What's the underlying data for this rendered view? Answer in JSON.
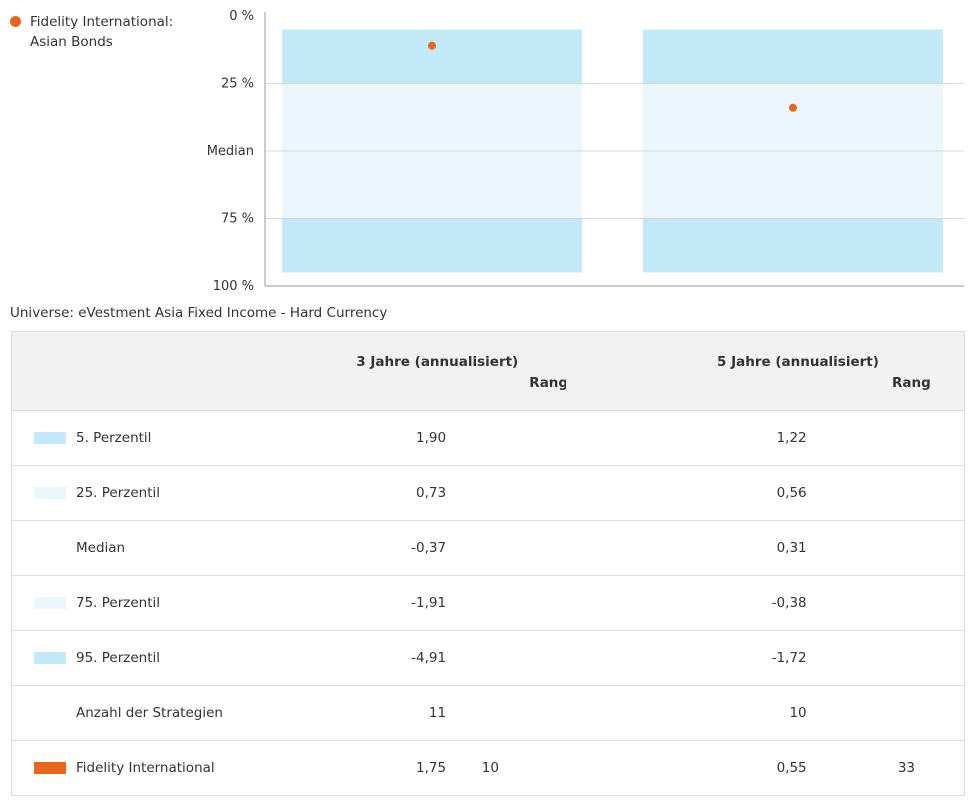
{
  "legend": {
    "line1": "Fidelity International:",
    "line2": "Asian Bonds",
    "color": "#e8671e"
  },
  "colors": {
    "outer_band": "#c3e8f7",
    "inner_band": "#ebf7fc",
    "fund": "#e8671e",
    "grid": "#d9d9d9",
    "axis": "#999999"
  },
  "chart_data": {
    "type": "percentile-range",
    "y_axis": {
      "ticks": [
        "0 %",
        "25 %",
        "Median",
        "75 %",
        "100 %"
      ],
      "tick_values": [
        0,
        25,
        50,
        75,
        100
      ],
      "reversed": true,
      "range": [
        0,
        100
      ]
    },
    "bands": {
      "outer": [
        5,
        95
      ],
      "inner": [
        25,
        75
      ]
    },
    "series": [
      {
        "name": "Fidelity International: Asian Bonds",
        "values": [
          11,
          34
        ]
      }
    ],
    "categories": [
      "3 Jahre (annualisiert)",
      "5 Jahre (annualisiert)"
    ]
  },
  "universe": "Universe: eVestment Asia Fixed Income - Hard Currency",
  "table": {
    "headers": {
      "p3": "3 Jahre (annualisiert)",
      "p5": "5 Jahre (annualisiert)",
      "rang": "Rang"
    },
    "rows": [
      {
        "label": "5. Perzentil",
        "swatch": "#c3e8f7",
        "v3": "1,90",
        "r3": "",
        "v5": "1,22",
        "r5": ""
      },
      {
        "label": "25. Perzentil",
        "swatch": "#ebf7fc",
        "v3": "0,73",
        "r3": "",
        "v5": "0,56",
        "r5": ""
      },
      {
        "label": "Median",
        "swatch": "",
        "v3": "-0,37",
        "r3": "",
        "v5": "0,31",
        "r5": ""
      },
      {
        "label": "75. Perzentil",
        "swatch": "#ebf7fc",
        "v3": "-1,91",
        "r3": "",
        "v5": "-0,38",
        "r5": ""
      },
      {
        "label": "95. Perzentil",
        "swatch": "#c3e8f7",
        "v3": "-4,91",
        "r3": "",
        "v5": "-1,72",
        "r5": ""
      },
      {
        "label": "Anzahl der Strategien",
        "swatch": "",
        "v3": "11",
        "r3": "",
        "v5": "10",
        "r5": ""
      },
      {
        "label": "Fidelity International",
        "swatch": "#e8671e",
        "v3": "1,75",
        "r3": "10",
        "v5": "0,55",
        "r5": "33"
      }
    ]
  }
}
